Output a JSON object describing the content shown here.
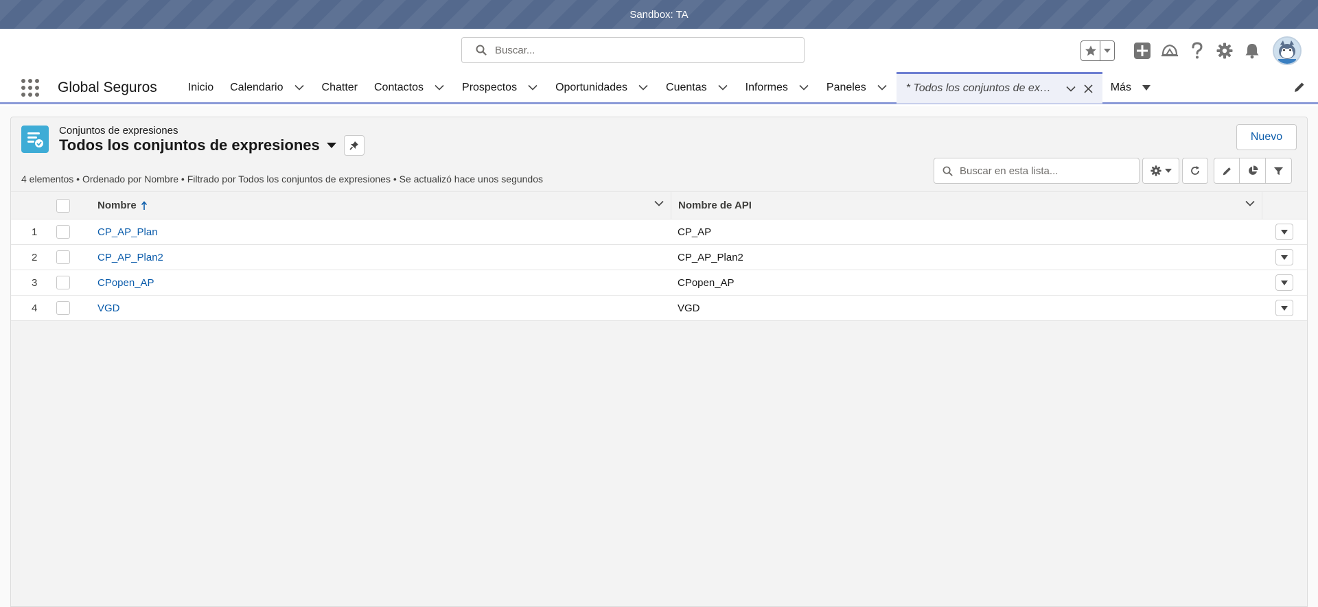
{
  "sandbox": {
    "label": "Sandbox: TA"
  },
  "header": {
    "search_placeholder": "Buscar..."
  },
  "nav": {
    "app_name": "Global Seguros",
    "items": [
      {
        "label": "Inicio",
        "has_menu": false
      },
      {
        "label": "Calendario",
        "has_menu": true
      },
      {
        "label": "Chatter",
        "has_menu": false
      },
      {
        "label": "Contactos",
        "has_menu": true
      },
      {
        "label": "Prospectos",
        "has_menu": true
      },
      {
        "label": "Oportunidades",
        "has_menu": true
      },
      {
        "label": "Cuentas",
        "has_menu": true
      },
      {
        "label": "Informes",
        "has_menu": true
      },
      {
        "label": "Paneles",
        "has_menu": true
      }
    ],
    "active_tab": "* Todos los conjuntos de exp...",
    "more": "Más"
  },
  "list": {
    "object_label": "Conjuntos de expresiones",
    "view_title": "Todos los conjuntos de expresiones",
    "new_button": "Nuevo",
    "meta": "4 elementos • Ordenado por Nombre • Filtrado por Todos los conjuntos de expresiones • Se actualizó hace unos segundos",
    "search_placeholder": "Buscar en esta lista...",
    "columns": {
      "name": "Nombre",
      "api": "Nombre de API"
    },
    "rows": [
      {
        "num": "1",
        "name": "CP_AP_Plan",
        "api": "CP_AP"
      },
      {
        "num": "2",
        "name": "CP_AP_Plan2",
        "api": "CP_AP_Plan2"
      },
      {
        "num": "3",
        "name": "CPopen_AP",
        "api": "CPopen_AP"
      },
      {
        "num": "4",
        "name": "VGD",
        "api": "VGD"
      }
    ]
  },
  "colors": {
    "sandbox_bar": "#54698d",
    "link": "#0b5cab",
    "active_tab_border": "#6d7ed1",
    "object_icon": "#3eacd6"
  }
}
